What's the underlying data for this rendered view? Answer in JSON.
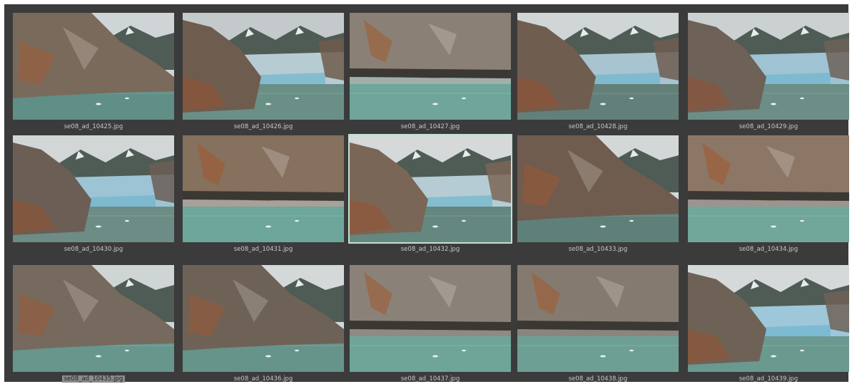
{
  "thumbnails": [
    {
      "filename": "se08_ad_10425.jpg",
      "sky": "#cfd5d6",
      "cliff": "#7a6a5c",
      "water": "#5f8f86",
      "glacier": "#c9dde0",
      "scene": "rock-left"
    },
    {
      "filename": "se08_ad_10426.jpg",
      "sky": "#c4cacb",
      "cliff": "#6e5c4e",
      "water": "#6a8f87",
      "glacier": "#b7ccd2",
      "scene": "glacier"
    },
    {
      "filename": "se08_ad_10427.jpg",
      "sky": "#9fb0aa",
      "cliff": "#8a8075",
      "water": "#6fa59a",
      "glacier": "#c8d6d4",
      "scene": "rock-top"
    },
    {
      "filename": "se08_ad_10428.jpg",
      "sky": "#d0d5d6",
      "cliff": "#6f5d50",
      "water": "#637f79",
      "glacier": "#a7c4d0",
      "scene": "glacier"
    },
    {
      "filename": "se08_ad_10429.jpg",
      "sky": "#cbd0d1",
      "cliff": "#6d6158",
      "water": "#6c8e86",
      "glacier": "#9fc3d3",
      "scene": "glacier"
    },
    {
      "filename": "se08_ad_10430.jpg",
      "sky": "#d2d6d7",
      "cliff": "#6b5e55",
      "water": "#6e8c86",
      "glacier": "#9dc4d4",
      "scene": "glacier"
    },
    {
      "filename": "se08_ad_10431.jpg",
      "sky": "#a7a19a",
      "cliff": "#86705e",
      "water": "#6da69a",
      "glacier": "#c7d3d0",
      "scene": "rock-top"
    },
    {
      "filename": "se08_ad_10432.jpg",
      "sky": "#d6d9da",
      "cliff": "#7a6656",
      "water": "#64877f",
      "glacier": "#b6ccd4",
      "scene": "glacier",
      "selected": true
    },
    {
      "filename": "se08_ad_10433.jpg",
      "sky": "#d3d7d8",
      "cliff": "#6f5c4f",
      "water": "#5f8079",
      "glacier": "#a6c3cf",
      "scene": "rock-left"
    },
    {
      "filename": "se08_ad_10434.jpg",
      "sky": "#9c958f",
      "cliff": "#8c7766",
      "water": "#71a69b",
      "glacier": "#c4d0ce",
      "scene": "rock-top"
    },
    {
      "filename": "se08_ad_10435.jpg",
      "sky": "#cfd4d5",
      "cliff": "#76695d",
      "water": "#66968c",
      "glacier": "#b9cfd4",
      "scene": "rock-left",
      "highlighted": true
    },
    {
      "filename": "se08_ad_10436.jpg",
      "sky": "#d4d8d9",
      "cliff": "#6e6256",
      "water": "#66938a",
      "glacier": "#a8c8d5",
      "scene": "rock-left"
    },
    {
      "filename": "se08_ad_10437.jpg",
      "sky": "#8f8a84",
      "cliff": "#8a8279",
      "water": "#6fa499",
      "glacier": "#c3cfcd",
      "scene": "rock-top"
    },
    {
      "filename": "se08_ad_10438.jpg",
      "sky": "#8b857f",
      "cliff": "#857a6f",
      "water": "#6d9f95",
      "glacier": "#c0ccca",
      "scene": "rock-top"
    },
    {
      "filename": "se08_ad_10439.jpg",
      "sky": "#d5d9da",
      "cliff": "#6e6257",
      "water": "#6a9990",
      "glacier": "#9ec7da",
      "scene": "glacier"
    }
  ]
}
